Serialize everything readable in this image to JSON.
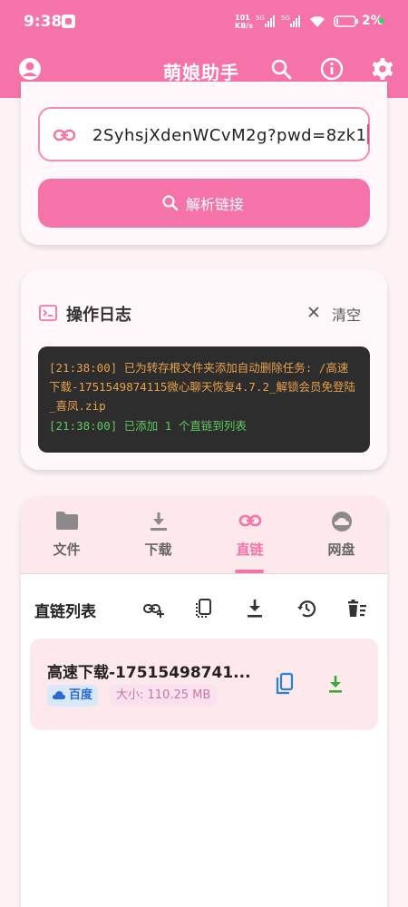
{
  "status_bar": {
    "time": "9:38",
    "net_speed_value": "101",
    "net_speed_unit": "KB/s",
    "battery": "2%"
  },
  "app_bar": {
    "title": "萌娘助手",
    "icons": [
      "account-icon",
      "search-icon",
      "info-icon",
      "settings-icon"
    ]
  },
  "parse": {
    "url_value": "2SyhsjXdenWCvM2g?pwd=8zk1",
    "button_label": "解析链接"
  },
  "log": {
    "title": "操作日志",
    "clear_label": "清空",
    "lines": [
      "[21:38:00] 已为转存根文件夹添加自动删除任务: /高速下载-1751549874115微心聊天恢复4.7.2_解锁会员免登陆_喜凤.zip",
      "[21:38:00] 已添加 1 个直链到列表"
    ]
  },
  "tabs": [
    {
      "label": "文件",
      "icon": "folder-icon",
      "active": false
    },
    {
      "label": "下载",
      "icon": "download-icon",
      "active": false
    },
    {
      "label": "直链",
      "icon": "link-icon",
      "active": true
    },
    {
      "label": "网盘",
      "icon": "cloud-icon",
      "active": false
    }
  ],
  "direct_links": {
    "title": "直链列表",
    "toolbar_icons": [
      "add-link-icon",
      "copy-all-icon",
      "download-all-icon",
      "history-icon",
      "clear-list-icon"
    ],
    "items": [
      {
        "name": "高速下载-17515498741...",
        "source": "百度",
        "size": "大小: 110.25 MB"
      }
    ]
  },
  "colors": {
    "primary": "#f673a9",
    "log_warn": "#e8a04a",
    "log_ok": "#5fc85f",
    "copy_blue": "#2a7fd6",
    "download_green": "#3aaa35"
  }
}
